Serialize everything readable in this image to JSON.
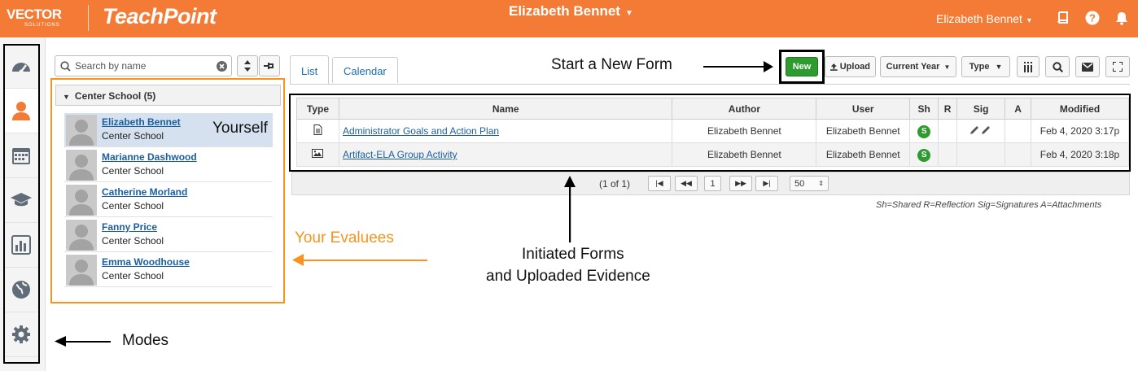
{
  "header": {
    "vector_logo": "VECTOR",
    "vector_sub": "SOLUTIONS",
    "app_name": "TeachPoint",
    "center_user": "Elizabeth Bennet",
    "right_user": "Elizabeth Bennet",
    "icons": [
      "book-icon",
      "help-icon",
      "bell-icon"
    ]
  },
  "modes": [
    "dashboard-icon",
    "person-icon",
    "calendar-icon",
    "graduation-cap-icon",
    "bar-chart-icon",
    "globe-icon",
    "gear-icon"
  ],
  "search": {
    "placeholder": "Search by name"
  },
  "group": {
    "label": "Center School (5)"
  },
  "people": [
    {
      "name": "Elizabeth Bennet",
      "school": "Center School",
      "selected": true
    },
    {
      "name": "Marianne Dashwood",
      "school": "Center School"
    },
    {
      "name": "Catherine Morland",
      "school": "Center School"
    },
    {
      "name": "Fanny Price",
      "school": "Center School"
    },
    {
      "name": "Emma Woodhouse",
      "school": "Center School"
    }
  ],
  "tabs": {
    "list": "List",
    "calendar": "Calendar"
  },
  "toolbar": {
    "new": "New",
    "upload": "Upload",
    "year": "Current Year",
    "type": "Type"
  },
  "table": {
    "headers": [
      "Type",
      "Name",
      "Author",
      "User",
      "Sh",
      "R",
      "Sig",
      "A",
      "Modified"
    ],
    "rows": [
      {
        "type_icon": "document-icon",
        "name": "Administrator Goals and Action Plan",
        "author": "Elizabeth Bennet",
        "user": "Elizabeth Bennet",
        "sh": "S",
        "modified": "Feb 4, 2020 3:17p"
      },
      {
        "type_icon": "image-icon",
        "name": "Artifact-ELA Group Activity",
        "author": "Elizabeth Bennet",
        "user": "Elizabeth Bennet",
        "sh": "S",
        "modified": "Feb 4, 2020 3:18p"
      }
    ]
  },
  "pager": {
    "count": "(1 of 1)",
    "page": "1",
    "per_page": "50"
  },
  "legend": "Sh=Shared R=Reflection Sig=Signatures A=Attachments",
  "annotations": {
    "new_form": "Start a New Form",
    "yourself": "Yourself",
    "evaluees": "Your Evaluees",
    "forms_line1": "Initiated Forms",
    "forms_line2": "and Uploaded Evidence",
    "modes": "Modes"
  },
  "colors": {
    "brand": "#f47b35",
    "accent_orange": "#f7931e",
    "link": "#1a5e9e",
    "new_green": "#2e9b2e"
  }
}
